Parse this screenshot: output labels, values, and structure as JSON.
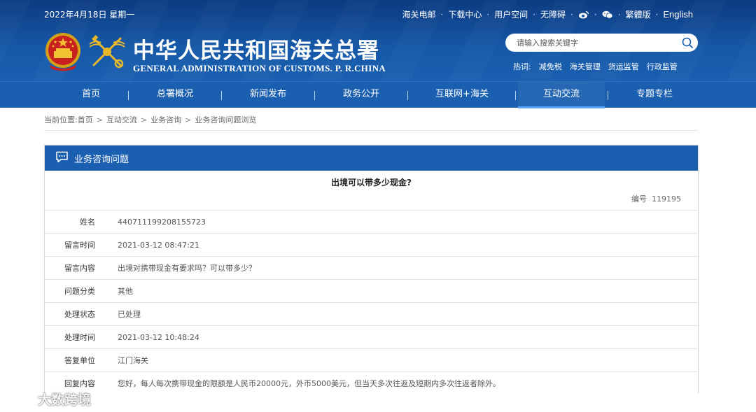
{
  "header": {
    "date": "2022年4月18日 星期一",
    "top_links": [
      "海关电邮",
      "下载中心",
      "用户空间",
      "无障碍"
    ],
    "traditional": "繁體版",
    "english": "English",
    "title_cn": "中华人民共和国海关总署",
    "title_en": "GENERAL ADMINISTRATION OF CUSTOMS. P. R.CHINA",
    "search_placeholder": "请输入搜索关键字",
    "hot_label": "热词:",
    "hot_words": [
      "减免税",
      "海关管理",
      "货运监管",
      "行政监管"
    ]
  },
  "nav": {
    "items": [
      "首页",
      "总署概况",
      "新闻发布",
      "政务公开",
      "互联网+海关",
      "互动交流",
      "专题专栏"
    ],
    "active_index": 5
  },
  "breadcrumb": {
    "label": "当前位置:",
    "items": [
      "首页",
      "互动交流",
      "业务咨询",
      "业务咨询问题浏览"
    ]
  },
  "panel": {
    "header": "业务咨询问题",
    "question_title": "出境可以带多少现金?",
    "number_label": "编号",
    "number_value": "119195",
    "rows": [
      {
        "key": "姓名",
        "value": "440711199208155723"
      },
      {
        "key": "留言时间",
        "value": "2021-03-12 08:47:21"
      },
      {
        "key": "留言内容",
        "value": "出境对携带现金有要求吗？可以带多少？"
      },
      {
        "key": "问题分类",
        "value": "其他"
      },
      {
        "key": "处理状态",
        "value": "已处理"
      },
      {
        "key": "处理时间",
        "value": "2021-03-12 10:48:24"
      },
      {
        "key": "答复单位",
        "value": "江门海关"
      },
      {
        "key": "回复内容",
        "value": "您好，每人每次携带现金的限额是人民币20000元，外币5000美元，但当天多次往返及短期内多次往返者除外。"
      }
    ]
  },
  "watermark": "大数跨境",
  "colors": {
    "header_blue": "#0d3b80",
    "nav_blue": "#1a5fb0",
    "active_underline": "#5aa3ff"
  }
}
